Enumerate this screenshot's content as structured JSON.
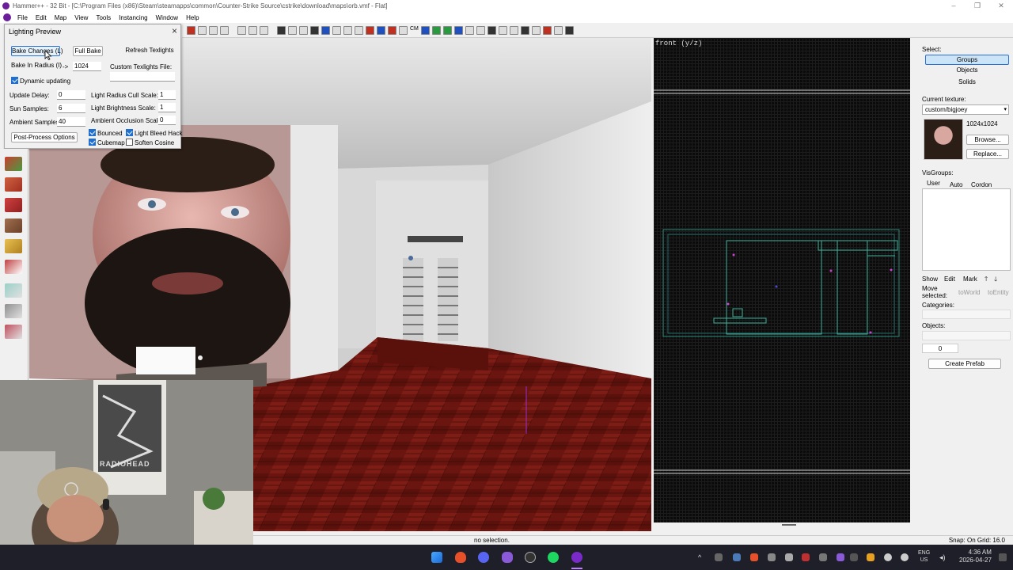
{
  "window": {
    "title": "Hammer++ - 32 Bit - [C:\\Program Files (x86)\\Steam\\steamapps\\common\\Counter-Strike Source\\cstrike\\download\\maps\\orb.vmf - Flat]",
    "minimize": "–",
    "maximize": "❐",
    "close": "✕"
  },
  "menu": [
    "File",
    "Edit",
    "Map",
    "View",
    "Tools",
    "Instancing",
    "Window",
    "Help"
  ],
  "toolbar": {
    "cm_label": "CM"
  },
  "lighting_preview": {
    "title": "Lighting Preview",
    "close": "×",
    "bake_changes": "Bake Changes (L)",
    "full_bake": "Full Bake",
    "refresh_texlights": "Refresh Texlights",
    "bake_in_radius": "Bake In Radius (I)",
    "arrow": "->",
    "radius_value": "1024",
    "custom_texlights_label": "Custom Texlights File:",
    "custom_texlights_value": "",
    "dynamic_updating": "Dynamic updating",
    "update_delay_label": "Update Delay:",
    "update_delay": "0",
    "sun_samples_label": "Sun Samples:",
    "sun_samples": "6",
    "ambient_samples_label": "Ambient Samples:",
    "ambient_samples": "40",
    "light_radius_cull_label": "Light Radius Cull Scale:",
    "light_radius_cull": "1",
    "light_brightness_label": "Light Brightness Scale:",
    "light_brightness": "1",
    "ambient_occlusion_label": "Ambient Occlusion Scale:",
    "ambient_occlusion": "0",
    "bounced": "Bounced",
    "light_bleed_hack": "Light Bleed Hack",
    "cubemap": "Cubemap",
    "soften_cosine": "Soften Cosine",
    "post_process": "Post-Process Options",
    "checks": {
      "dynamic": true,
      "bounced": true,
      "light_bleed": true,
      "cubemap": true,
      "soften": false
    }
  },
  "view2d": {
    "label": "front (y/z)"
  },
  "right_panel": {
    "select_label": "Select:",
    "groups": "Groups",
    "objects": "Objects",
    "solids": "Solids",
    "current_texture_label": "Current texture:",
    "texture_name": "custom/bigjoey",
    "texture_size": "1024x1024",
    "browse": "Browse...",
    "replace": "Replace...",
    "visgroups_label": "VisGroups:",
    "tab_user": "User",
    "tab_auto": "Auto",
    "tab_cordon": "Cordon",
    "show": "Show",
    "edit": "Edit",
    "mark": "Mark",
    "up": "🡑",
    "down": "🡓",
    "move_selected": "Move selected:",
    "to_world": "toWorld",
    "to_entity": "toEntity",
    "categories_label": "Categories:",
    "objects_label": "Objects:",
    "objects_count": "0",
    "create_prefab": "Create Prefab"
  },
  "webcam": {
    "poster_text": "RADIOHEAD"
  },
  "status": {
    "selection": "no selection.",
    "snap": "Snap: On Grid: 16.0"
  },
  "taskbar": {
    "lang": "ENG",
    "region": "US",
    "time": "4:36 AM",
    "date": "2026-04-27"
  }
}
